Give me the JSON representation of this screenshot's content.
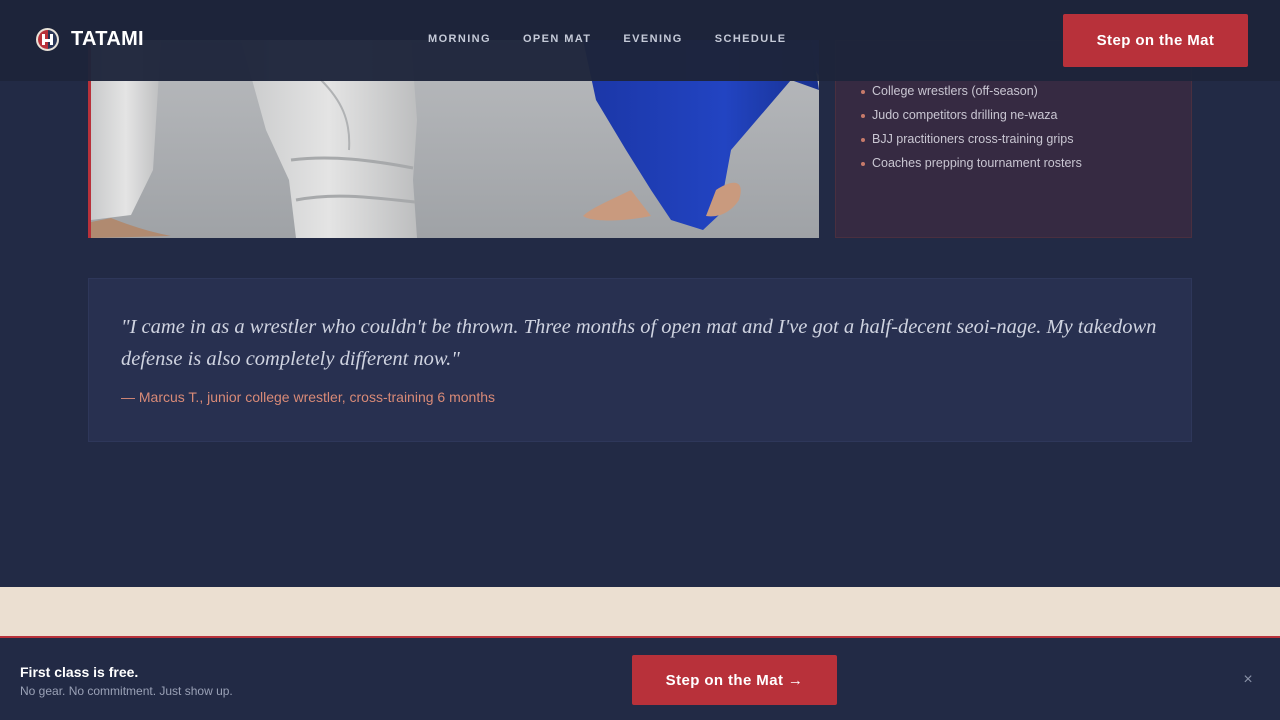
{
  "header": {
    "brand": "TATAMI",
    "nav": [
      "MORNING",
      "OPEN MAT",
      "EVENING",
      "SCHEDULE"
    ],
    "cta_label": "Step on the Mat"
  },
  "audience": {
    "items": [
      "College wrestlers (off-season)",
      "Judo competitors drilling ne-waza",
      "BJJ practitioners cross-training grips",
      "Coaches prepping tournament rosters"
    ]
  },
  "testimonial": {
    "quote": "\"I came in as a wrestler who couldn't be thrown. Three months of open mat and I've got a half-decent seoi-nage. My takedown defense is also completely different now.\"",
    "attribution": "— Marcus T., junior college wrestler, cross-training 6 months"
  },
  "sticky": {
    "title": "First class is free.",
    "subtitle": "No gear. No commitment. Just show up.",
    "cta_label": "Step on the Mat →",
    "close_glyph": "×"
  },
  "colors": {
    "accent": "#b8313a",
    "background": "#222a45",
    "quote_attr": "#d98a77",
    "band": "#ebdfd1"
  },
  "icons": {
    "logo": "tatami-logo-icon",
    "close": "close-icon",
    "bullet": "bullet-dot-icon"
  }
}
